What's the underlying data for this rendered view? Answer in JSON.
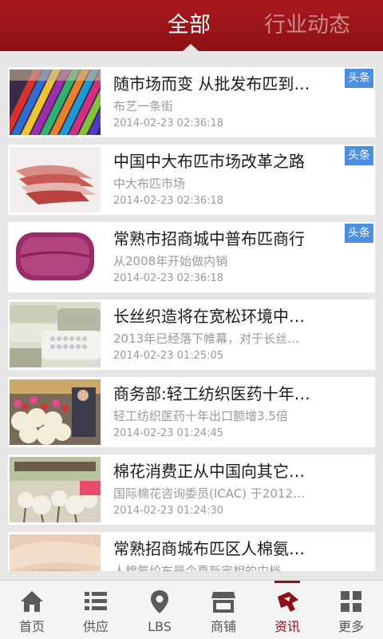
{
  "header": {
    "tab_all": "全部",
    "tab_news": "行业动态"
  },
  "badge_label": "头条",
  "items": [
    {
      "title": "随市场而变 从批发布匹到…",
      "subtitle": "布艺一条街",
      "time": "2014-02-23 02:36:18",
      "badge": true
    },
    {
      "title": "中国中大布匹市场改革之路",
      "subtitle": "中大布匹市场",
      "time": "2014-02-23 02:36:18",
      "badge": true
    },
    {
      "title": "常熟市招商城中普布匹商行",
      "subtitle": "从2008年开始做内销",
      "time": "2014-02-23 02:36:18",
      "badge": true
    },
    {
      "title": "长丝织造将在宽松环境中…",
      "subtitle": "2013年已经落下帷幕，对于长丝…",
      "time": "2014-02-23 01:25:05",
      "badge": false
    },
    {
      "title": "商务部:轻工纺织医药十年…",
      "subtitle": "轻工纺织医药十年出口额增3.5倍",
      "time": "2014-02-23 01:24:45",
      "badge": false
    },
    {
      "title": "棉花消费正从中国向其它…",
      "subtitle": "国际棉花咨询委员(ICAC) 于2012…",
      "time": "2014-02-23 01:24:30",
      "badge": false
    },
    {
      "title": "常熟招商城布匹区人棉氨…",
      "subtitle": "人棉氨纶布是今夏新宠相的中档…",
      "time": "",
      "badge": false
    }
  ],
  "nav": {
    "items": [
      {
        "label": "首页",
        "icon": "home-icon"
      },
      {
        "label": "供应",
        "icon": "list-icon"
      },
      {
        "label": "LBS",
        "icon": "location-pin-icon"
      },
      {
        "label": "商铺",
        "icon": "shop-icon"
      },
      {
        "label": "资讯",
        "icon": "news-icon"
      },
      {
        "label": "更多",
        "icon": "grid-icon"
      }
    ],
    "active": "资讯"
  },
  "colors": {
    "header_red": "#8e1014",
    "badge_blue": "#4a8fe3",
    "active_red": "#8e1014"
  }
}
